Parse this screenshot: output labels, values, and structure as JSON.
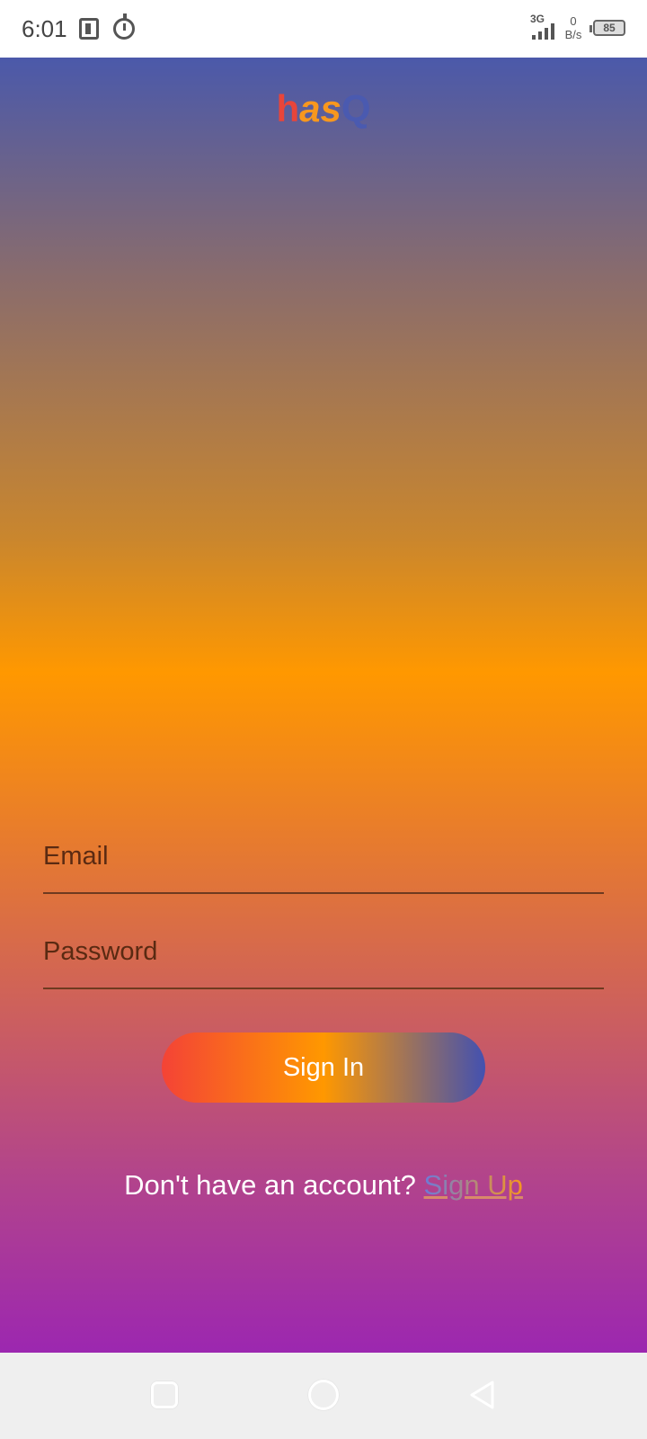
{
  "status_bar": {
    "time": "6:01",
    "network_type": "3G",
    "speed_value": "0",
    "speed_unit": "B/s",
    "battery": "85"
  },
  "app": {
    "brand_part1": "h",
    "brand_part2": "as",
    "brand_part3": "Q",
    "email_placeholder": "Email",
    "password_placeholder": "Password",
    "signin_label": "Sign In",
    "signup_prompt": "Don't have an account? ",
    "signup_link": "Sign Up"
  },
  "colors": {
    "gradient_top": "#4b59aa",
    "gradient_mid": "#ff9800",
    "gradient_bottom": "#9c27b0",
    "button_start": "#f44336",
    "button_end": "#4351b0"
  },
  "nav_bar": {
    "recents_icon": "square-icon",
    "home_icon": "circle-icon",
    "back_icon": "triangle-back-icon"
  }
}
